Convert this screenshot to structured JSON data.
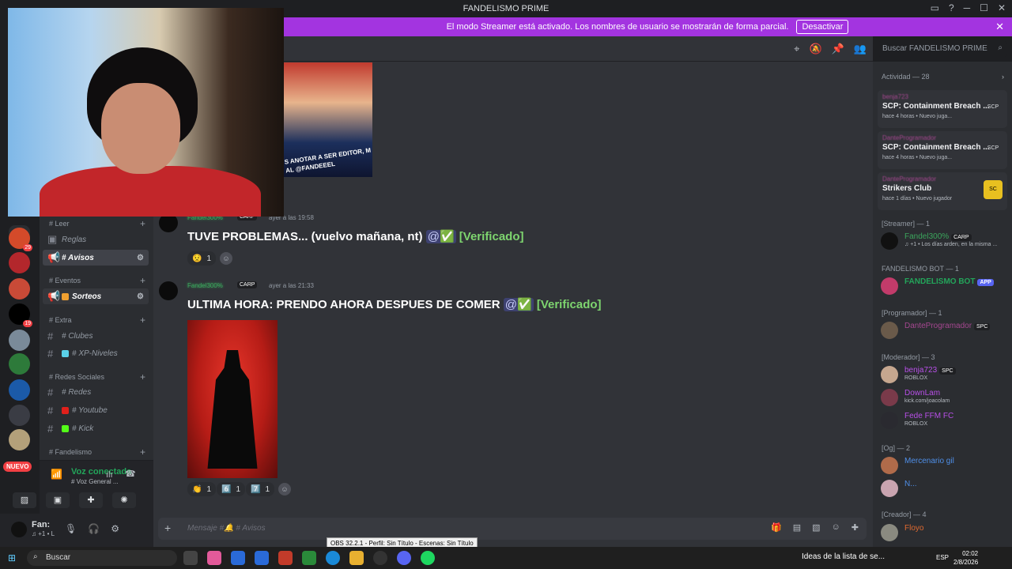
{
  "window": {
    "title": "FANDELISMO PRIME"
  },
  "streamer_bar": {
    "text": "El modo Streamer está activado. Los nombres de usuario se mostrarán de forma parcial.",
    "button": "Desactivar"
  },
  "search": {
    "placeholder": "Buscar FANDELISMO PRIME"
  },
  "guilds": {
    "badges": [
      "29",
      "19"
    ],
    "new_label": "NUEVO"
  },
  "channels": {
    "categories": [
      {
        "label": "# Leer"
      },
      {
        "label": "# Eventos"
      },
      {
        "label": "# Extra"
      },
      {
        "label": "# Redes Sociales"
      },
      {
        "label": "# Fandelismo"
      }
    ],
    "items": [
      {
        "label": "Reglas"
      },
      {
        "label": "# Avisos"
      },
      {
        "label": "Sorteos"
      },
      {
        "label": "# Clubes"
      },
      {
        "label": "# XP-Niveles"
      },
      {
        "label": "# Redes"
      },
      {
        "label": "# Youtube"
      },
      {
        "label": "# Kick"
      }
    ]
  },
  "voice": {
    "title": "Voz conectada",
    "sub": "# Voz General ..."
  },
  "user": {
    "name": "Fan:",
    "status": "♫ +1 • L"
  },
  "messages": [
    {
      "user": "Fandel300%",
      "tag": "CARP",
      "time": "ayer a las 19:58",
      "text": "TUVE PROBLEMAS... (vuelvo mañana, nt)",
      "mention": "@✅",
      "verified": "[Verificado]",
      "reactions": [
        {
          "emoji": "😟",
          "count": "1"
        }
      ]
    },
    {
      "user": "Fandel300%",
      "tag": "CARP",
      "time": "ayer a las 21:33",
      "text": "ULTIMA HORA: PRENDO AHORA DESPUES DE COMER",
      "mention": "@✅",
      "verified": "[Verificado]",
      "reactions": [
        {
          "emoji": "👏",
          "count": "1"
        },
        {
          "emoji": "6️⃣",
          "count": "1"
        },
        {
          "emoji": "7️⃣",
          "count": "1"
        }
      ]
    }
  ],
  "embed_caption": "S ANOTAR A SER EDITOR, M AL @FANDEEEL",
  "composer": {
    "placeholder": "Mensaje #🔔 # Avisos"
  },
  "members": {
    "activity_title": "Actividad — 28",
    "activity": [
      {
        "user": "benja723",
        "game": "SCP: Containment Breach ...",
        "meta": "hace 4 horas  • Nuevo juga...",
        "logo": "SCP"
      },
      {
        "user": "DanteProgramador",
        "game": "SCP: Containment Breach ...",
        "meta": "hace 4 horas  • Nuevo juga...",
        "logo": "SCP"
      },
      {
        "user": "DanteProgramador",
        "game": "Strikers Club",
        "meta": "hace 1 días  • Nuevo jugador",
        "logo": "SC"
      }
    ],
    "groups": [
      {
        "title": "[Streamer] — 1",
        "members": [
          {
            "name": "Fandel300%",
            "tag": "CARP",
            "sub": "♫ +1 • Los días arden, en la misma ..."
          }
        ]
      },
      {
        "title": "FANDELISMO BOT — 1",
        "members": [
          {
            "name": "FANDELISMO BOT",
            "tag": "APP",
            "sub": ""
          }
        ]
      },
      {
        "title": "[Programador] — 1",
        "members": [
          {
            "name": "DanteProgramador",
            "tag": "SPC",
            "sub": ""
          }
        ]
      },
      {
        "title": "[Moderador] — 3",
        "members": [
          {
            "name": "benja723",
            "tag": "SPC",
            "sub": "ROBLOX"
          },
          {
            "name": "DownLam",
            "tag": "",
            "sub": "kick.com/joacolam"
          },
          {
            "name": "Fede FFM FC",
            "tag": "",
            "sub": "ROBLOX"
          }
        ]
      },
      {
        "title": "[Og] — 2",
        "members": [
          {
            "name": "Mercenario gil",
            "tag": "",
            "sub": ""
          },
          {
            "name": "N...",
            "tag": "",
            "sub": ""
          }
        ]
      },
      {
        "title": "[Creador] — 4",
        "members": [
          {
            "name": "Floyo",
            "tag": "",
            "sub": ""
          }
        ]
      }
    ]
  },
  "taskbar": {
    "search": "Buscar",
    "notification": "Ideas de la lista de se...",
    "lang": "ESP",
    "time": "02:02",
    "date": "2/8/2026"
  },
  "tooltip": "OBS 32.2.1 - Perfil: Sin Título - Escenas: Sin Título",
  "colors": {
    "streamer": "#a334e0",
    "online": "#23a55a",
    "accent": "#5865f2"
  }
}
